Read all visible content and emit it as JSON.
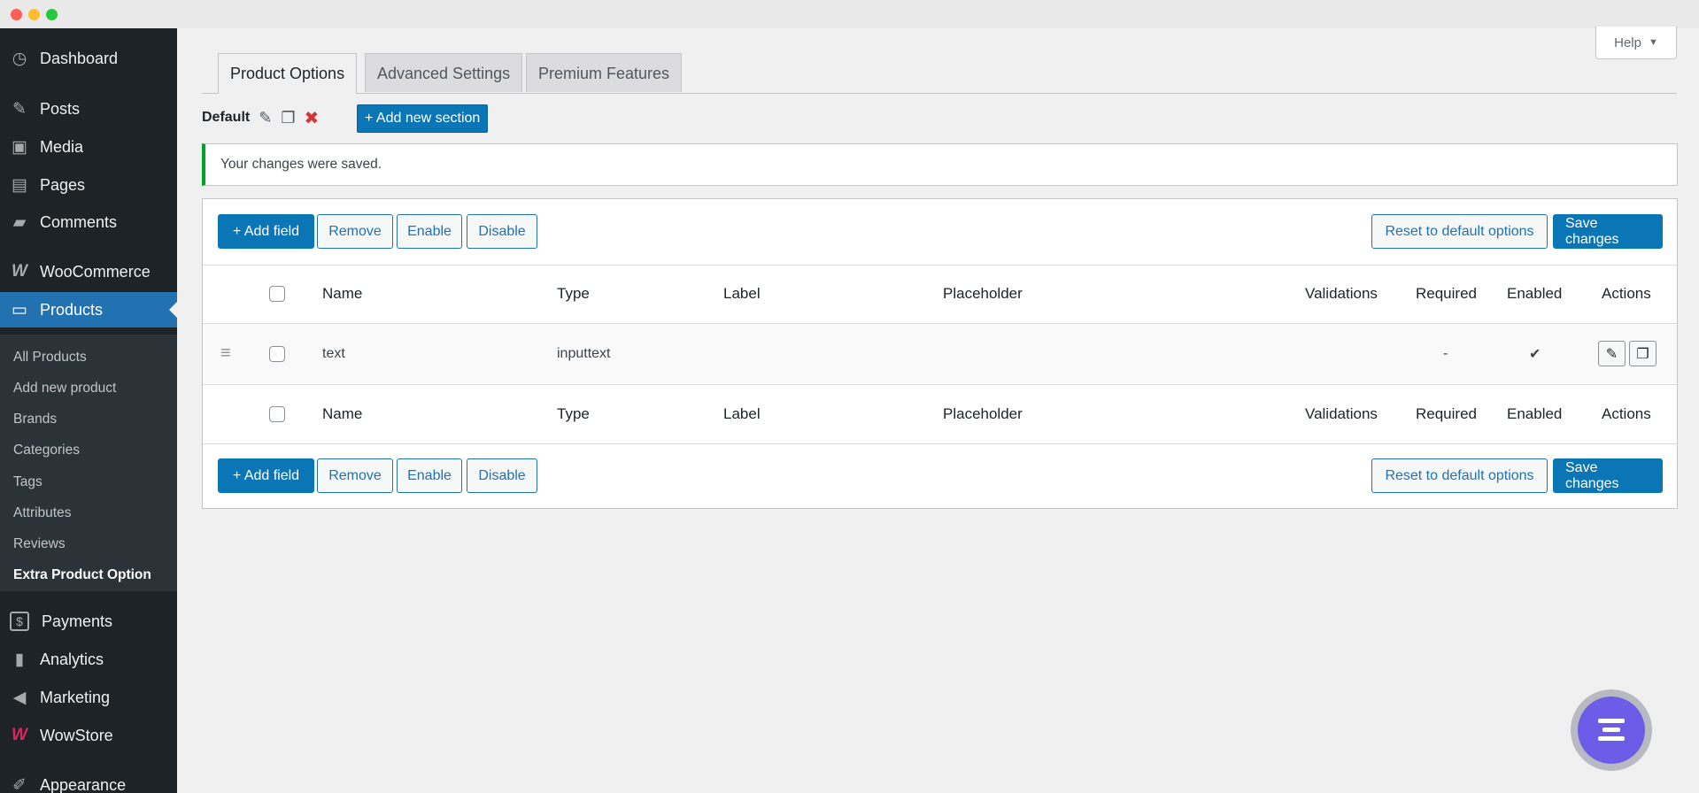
{
  "sidebar": {
    "items": [
      {
        "label": "Dashboard",
        "icon": "dashboard-icon",
        "glyph": "◷"
      },
      {
        "label": "Posts",
        "icon": "pin-icon",
        "glyph": "✎"
      },
      {
        "label": "Media",
        "icon": "media-icon",
        "glyph": "▣"
      },
      {
        "label": "Pages",
        "icon": "pages-icon",
        "glyph": "▤"
      },
      {
        "label": "Comments",
        "icon": "comments-icon",
        "glyph": "▰"
      },
      {
        "label": "WooCommerce",
        "icon": "woocommerce-icon",
        "glyph": "W"
      },
      {
        "label": "Products",
        "icon": "archive-icon",
        "glyph": "▭"
      },
      {
        "label": "Payments",
        "icon": "dollar-icon",
        "glyph": "$"
      },
      {
        "label": "Analytics",
        "icon": "bar-chart-icon",
        "glyph": "▮"
      },
      {
        "label": "Marketing",
        "icon": "megaphone-icon",
        "glyph": "◀"
      },
      {
        "label": "WowStore",
        "icon": "wowstore-icon",
        "glyph": "W"
      },
      {
        "label": "Appearance",
        "icon": "brush-icon",
        "glyph": "✐"
      }
    ],
    "products_submenu": [
      "All Products",
      "Add new product",
      "Brands",
      "Categories",
      "Tags",
      "Attributes",
      "Reviews",
      "Extra Product Option"
    ]
  },
  "help": {
    "label": "Help",
    "caret": "▼"
  },
  "tabs": [
    "Product Options",
    "Advanced Settings",
    "Premium Features"
  ],
  "section": {
    "name": "Default",
    "add_label": "+ Add new section"
  },
  "notice": "Your changes were saved.",
  "toolbar": {
    "add_field": "+ Add field",
    "remove": "Remove",
    "enable": "Enable",
    "disable": "Disable",
    "reset": "Reset to default options",
    "save": "Save changes"
  },
  "columns": [
    "Name",
    "Type",
    "Label",
    "Placeholder",
    "Validations",
    "Required",
    "Enabled",
    "Actions"
  ],
  "rows": [
    {
      "name": "text",
      "type": "inputtext",
      "label": "",
      "placeholder": "",
      "validations": "",
      "required": "-",
      "enabled": "✔"
    }
  ],
  "colors": {
    "accent": "#2271b1",
    "primary_button": "#0a76b5",
    "success": "#00a32a",
    "fab": "#6c5ce7"
  }
}
